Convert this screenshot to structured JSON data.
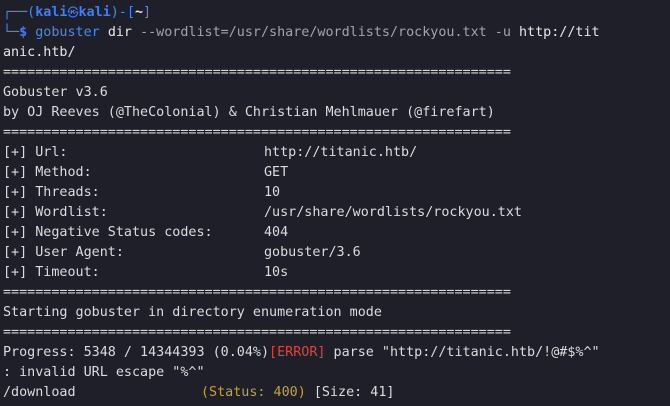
{
  "prompt": {
    "corner_top": "┌──(",
    "user": "kali",
    "skull_icon": "㉿",
    "host": "kali",
    "after_host": ")-[",
    "dir": "~",
    "close": "]",
    "corner_bottom": "└─",
    "dollar": "$",
    "command": "gobuster",
    "subcommand": "dir",
    "args": "--wordlist=/usr/share/wordlists/rockyou.txt -u",
    "url_part1": "http://tit",
    "url_part2": "anic.htb/"
  },
  "separator": "===============================================================",
  "banner": {
    "version": "Gobuster v3.6",
    "authors": "by OJ Reeves (@TheColonial) & Christian Mehlmauer (@firefart)"
  },
  "config": [
    {
      "label": "[+] Url:",
      "value": "http://titanic.htb/"
    },
    {
      "label": "[+] Method:",
      "value": "GET"
    },
    {
      "label": "[+] Threads:",
      "value": "10"
    },
    {
      "label": "[+] Wordlist:",
      "value": "/usr/share/wordlists/rockyou.txt"
    },
    {
      "label": "[+] Negative Status codes:",
      "value": "404"
    },
    {
      "label": "[+] User Agent:",
      "value": "gobuster/3.6"
    },
    {
      "label": "[+] Timeout:",
      "value": "10s"
    }
  ],
  "start_msg": "Starting gobuster in directory enumeration mode",
  "progress": {
    "text": "Progress: 5348 / 14344393 (0.04%)",
    "error_tag": "[ERROR]",
    "error_msg": " parse \"http://titanic.htb/!@#$%^\"",
    "error_cont": ": invalid URL escape \"%^\""
  },
  "result": {
    "path": "/download",
    "status": "(Status: 400)",
    "size": " [Size: 41]"
  },
  "colors": {
    "background": "#1e1f29",
    "prompt_blue": "#3d7dff",
    "error_red": "#e0443a",
    "status_yellow": "#c9a227"
  }
}
